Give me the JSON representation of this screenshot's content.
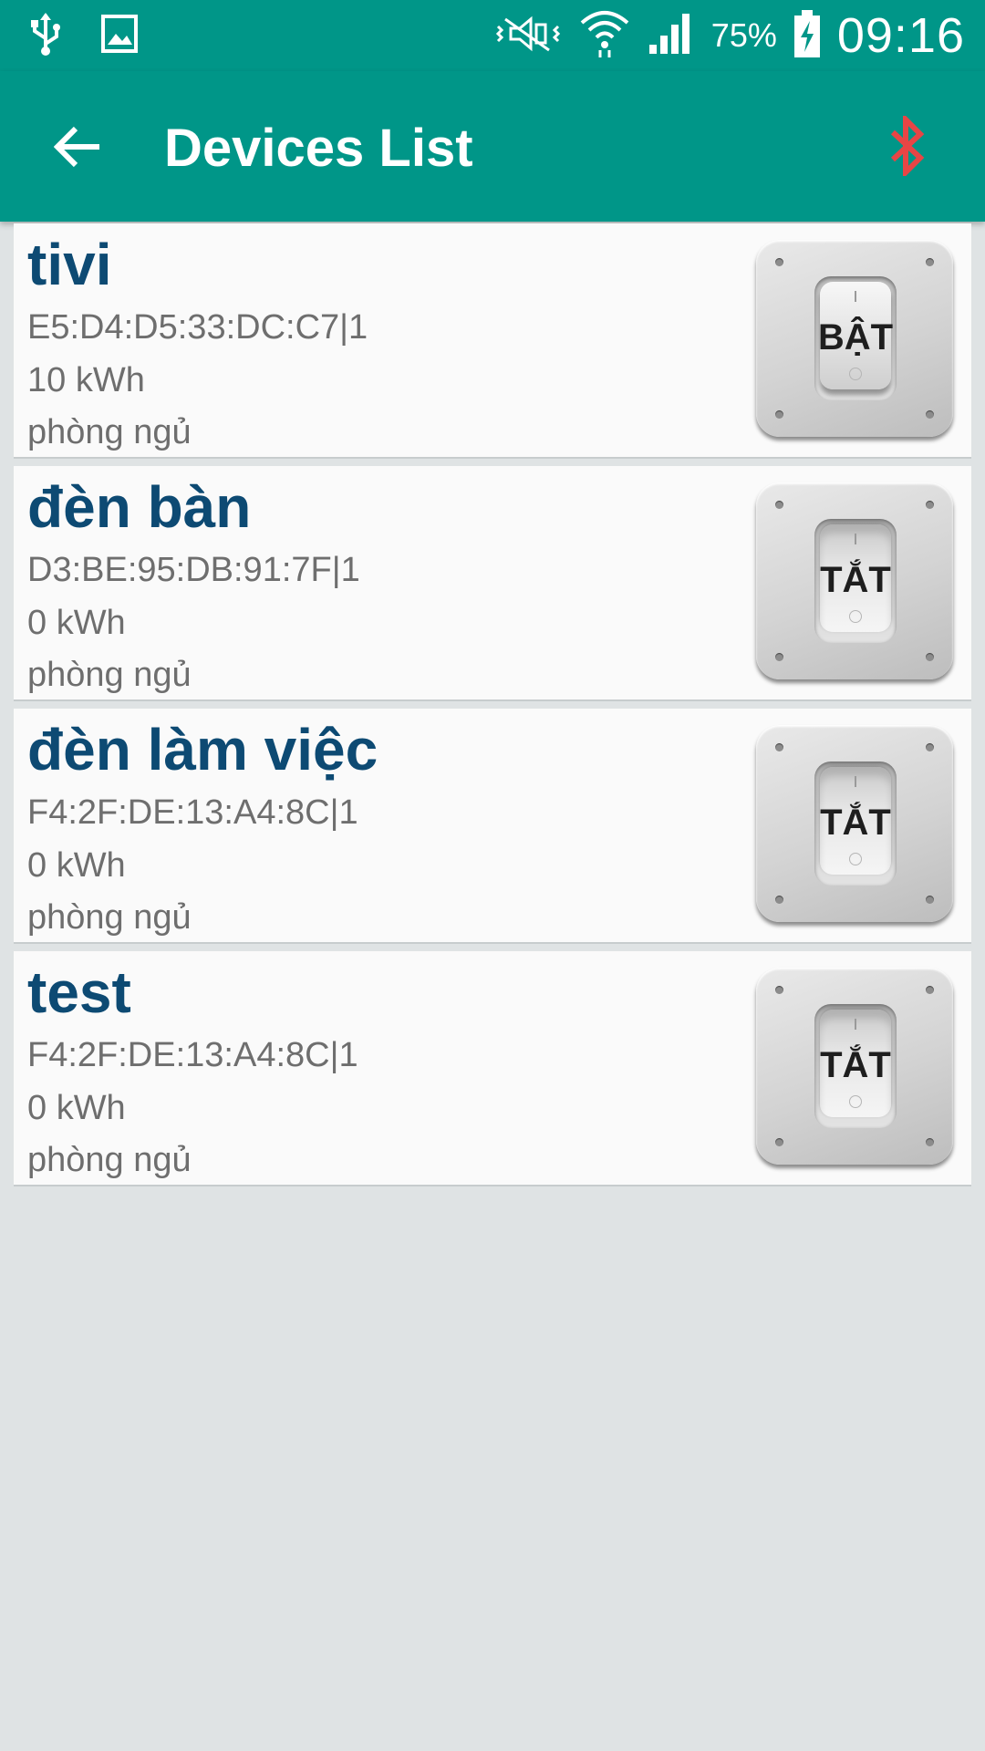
{
  "status_bar": {
    "icons": [
      "usb-icon",
      "image-icon",
      "vibrate-icon",
      "wifi-icon",
      "signal-icon",
      "battery-charging-icon"
    ],
    "battery_percent": "75%",
    "time": "09:16"
  },
  "app_bar": {
    "title": "Devices List",
    "back_icon": "arrow-left-icon",
    "bluetooth_icon": "bluetooth-icon",
    "colors": {
      "primary": "#009688",
      "bluetooth": "#e84545"
    }
  },
  "devices": [
    {
      "name": "tivi",
      "address": "E5:D4:D5:33:DC:C7|1",
      "energy": "10 kWh",
      "room": "phòng ngủ",
      "switch_label": "BẬT",
      "state": "on"
    },
    {
      "name": "đèn bàn",
      "address": "D3:BE:95:DB:91:7F|1",
      "energy": "0 kWh",
      "room": "phòng ngủ",
      "switch_label": "TẮT",
      "state": "off"
    },
    {
      "name": "đèn làm việc",
      "address": "F4:2F:DE:13:A4:8C|1",
      "energy": "0 kWh",
      "room": "phòng ngủ",
      "switch_label": "TẮT",
      "state": "off"
    },
    {
      "name": "test",
      "address": "F4:2F:DE:13:A4:8C|1",
      "energy": "0 kWh",
      "room": "phòng ngủ",
      "switch_label": "TẮT",
      "state": "off"
    }
  ]
}
